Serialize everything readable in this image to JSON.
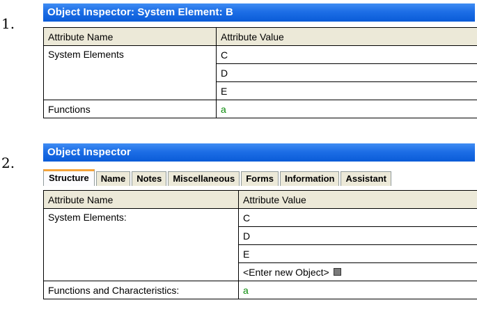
{
  "list_numbers": [
    "1.",
    "2."
  ],
  "panel1": {
    "title": "Object Inspector: System Element: B",
    "headers": [
      "Attribute Name",
      "Attribute Value"
    ],
    "rows": {
      "system_elements_label": "System Elements",
      "system_elements_values": [
        "C",
        "D",
        "E"
      ],
      "functions_label": "Functions",
      "functions_value": "a"
    }
  },
  "panel2": {
    "title": "Object Inspector",
    "tabs": [
      "Structure",
      "Name",
      "Notes",
      "Miscellaneous",
      "Forms",
      "Information",
      "Assistant"
    ],
    "active_tab": "Structure",
    "headers": [
      "Attribute Name",
      "Attribute Value"
    ],
    "rows": {
      "system_elements_label": "System Elements:",
      "system_elements_values": [
        "C",
        "D",
        "E"
      ],
      "new_object_placeholder": "<Enter new Object>",
      "functions_label": "Functions and Characteristics:",
      "functions_value": "a"
    }
  },
  "colors": {
    "title_bar": "#1d6ee6",
    "header_bg": "#ece9d8",
    "active_tab_accent": "#f5a43a",
    "function_value": "#0a8a0a"
  },
  "icons": {
    "new_object": "small-square-icon"
  }
}
